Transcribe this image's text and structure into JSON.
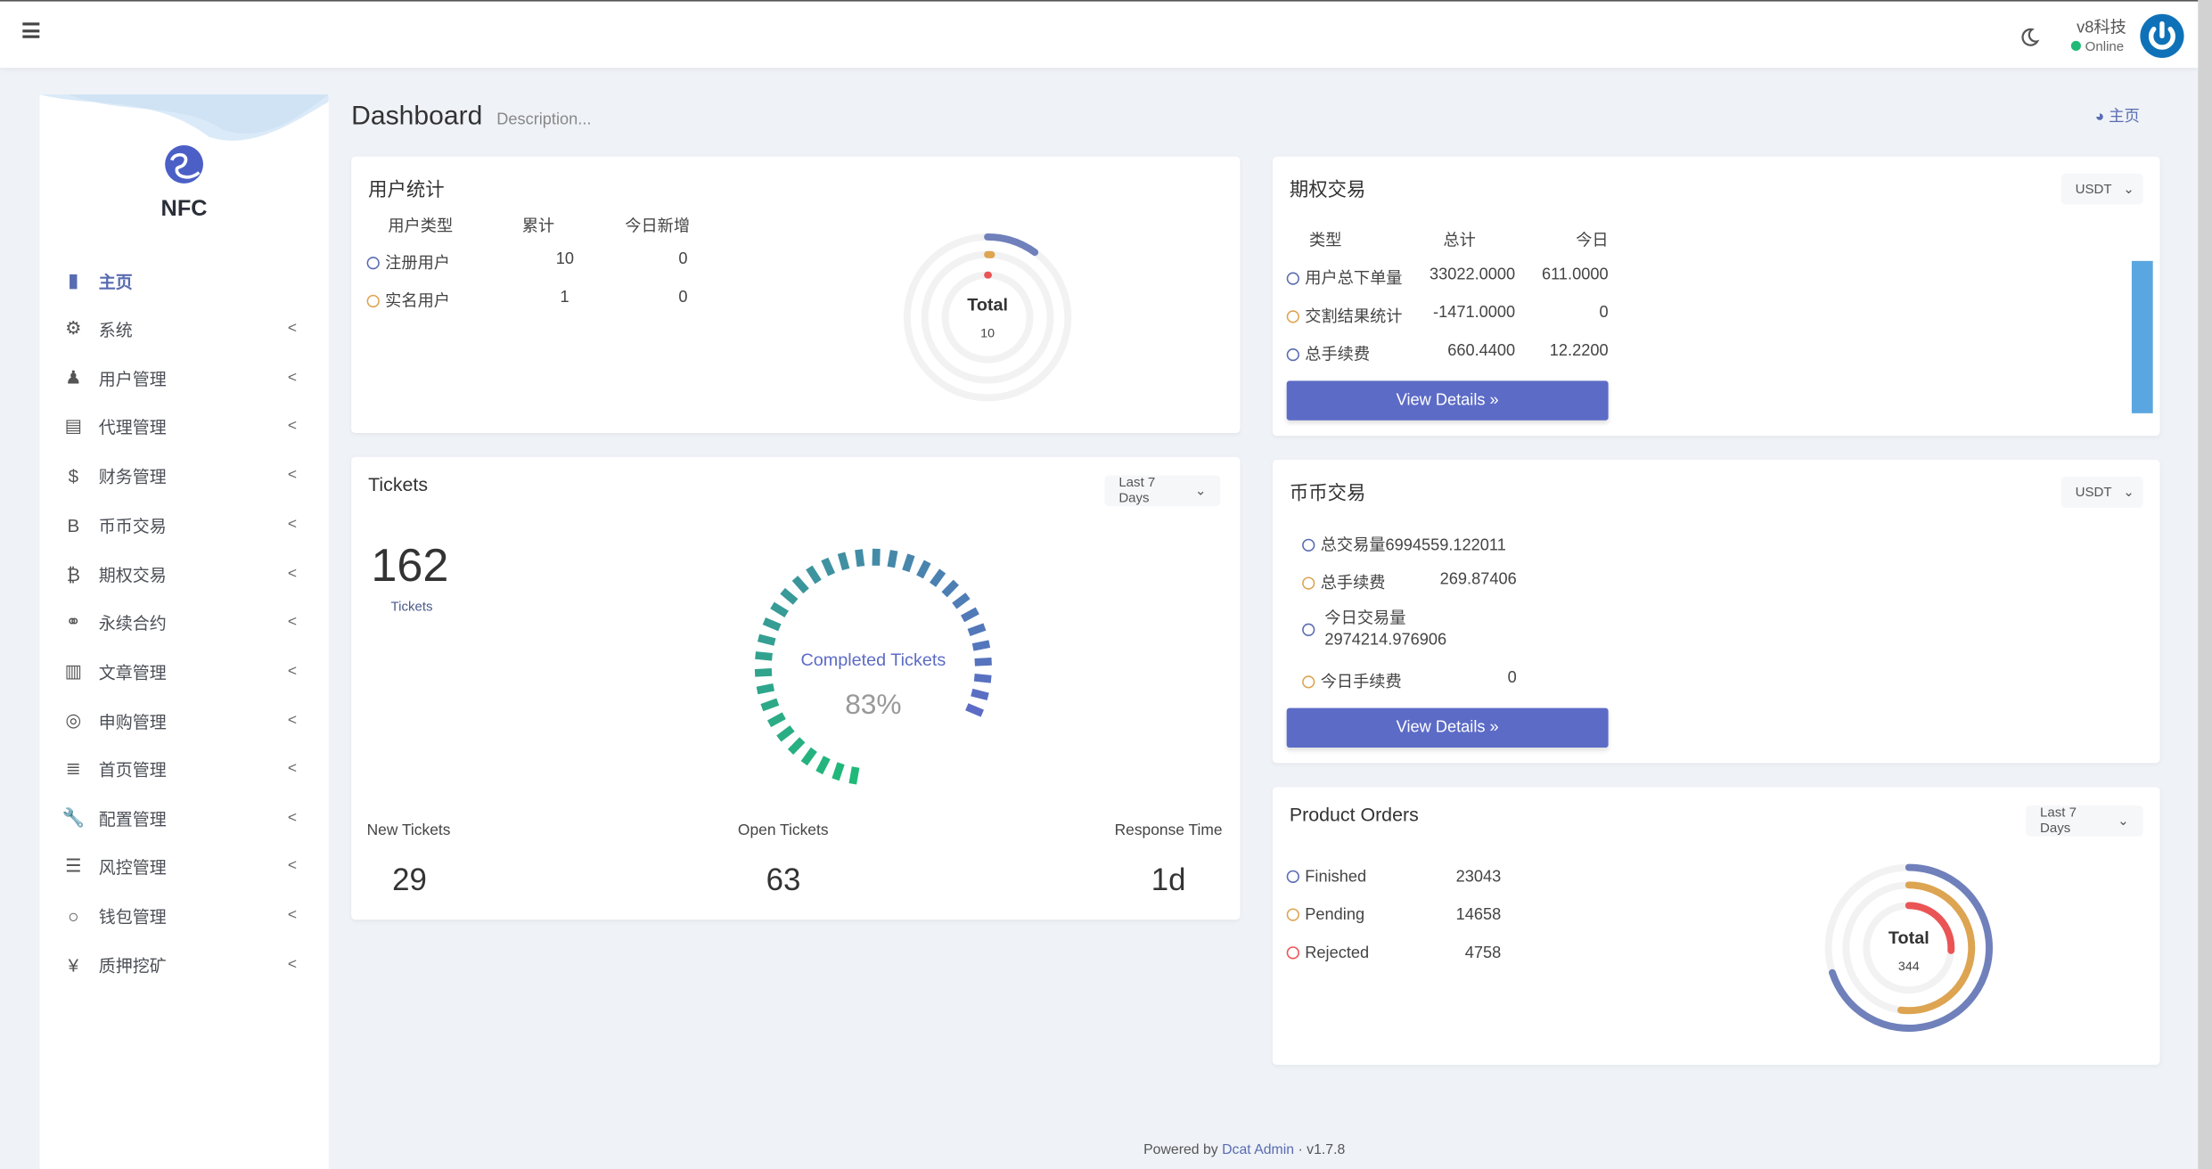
{
  "navbar": {
    "menu_icon": "hamburger-icon",
    "theme_icon": "moon-icon",
    "username": "v8科技",
    "status": "Online",
    "status_color": "#21b978",
    "avatar_icon": "power-icon"
  },
  "sidebar": {
    "logo_text": "NFC",
    "items": [
      {
        "label": "主页",
        "icon": "bar-chart-icon",
        "active": true
      },
      {
        "label": "系统",
        "icon": "gear-icon"
      },
      {
        "label": "用户管理",
        "icon": "user-icon"
      },
      {
        "label": "代理管理",
        "icon": "id-card-icon"
      },
      {
        "label": "财务管理",
        "icon": "dollar-icon"
      },
      {
        "label": "币币交易",
        "icon": "b-letter-icon"
      },
      {
        "label": "期权交易",
        "icon": "bitcoin-icon"
      },
      {
        "label": "永续合约",
        "icon": "link-icon"
      },
      {
        "label": "文章管理",
        "icon": "newspaper-icon"
      },
      {
        "label": "申购管理",
        "icon": "life-ring-icon"
      },
      {
        "label": "首页管理",
        "icon": "list-icon"
      },
      {
        "label": "配置管理",
        "icon": "wrench-icon"
      },
      {
        "label": "风控管理",
        "icon": "indent-icon"
      },
      {
        "label": "钱包管理",
        "icon": "circle-icon"
      },
      {
        "label": "质押挖矿",
        "icon": "yen-icon"
      }
    ]
  },
  "header": {
    "title": "Dashboard",
    "description": "Description...",
    "breadcrumb": "主页"
  },
  "user_stats": {
    "title": "用户统计",
    "columns": [
      "用户类型",
      "累计",
      "今日新增"
    ],
    "rows": [
      {
        "type": "注册用户",
        "total": "10",
        "today": "0"
      },
      {
        "type": "实名用户",
        "total": "1",
        "today": "0"
      }
    ],
    "chart_total_label": "Total",
    "chart_total": "10",
    "chart_values": [
      10,
      1,
      0
    ]
  },
  "options_trade": {
    "title": "期权交易",
    "select": "USDT",
    "columns": [
      "类型",
      "总计",
      "今日"
    ],
    "rows": [
      {
        "type": "用户总下单量",
        "total": "33022.0000",
        "today": "611.0000"
      },
      {
        "type": "交割结果统计",
        "total": "-1471.0000",
        "today": "0"
      },
      {
        "type": "总手续费",
        "total": "660.4400",
        "today": "12.2200"
      }
    ],
    "button": "View Details »"
  },
  "tickets": {
    "title": "Tickets",
    "select": "Last 7 Days",
    "count": "162",
    "count_label": "Tickets",
    "gauge_label": "Completed Tickets",
    "gauge_value": 83,
    "gauge_text": "83%",
    "stats": [
      {
        "label": "New Tickets",
        "value": "29"
      },
      {
        "label": "Open Tickets",
        "value": "63"
      },
      {
        "label": "Response Time",
        "value": "1d"
      }
    ]
  },
  "coin_trade": {
    "title": "币币交易",
    "select": "USDT",
    "rows": [
      {
        "label": "总交易量",
        "value": "6994559.122011"
      },
      {
        "label": "总手续费",
        "value": "269.87406"
      },
      {
        "label": "今日交易量",
        "value": "2974214.976906"
      },
      {
        "label": "今日手续费",
        "value": "0"
      }
    ],
    "button": "View Details »"
  },
  "product_orders": {
    "title": "Product Orders",
    "select": "Last 7 Days",
    "rows": [
      {
        "label": "Finished",
        "value": "23043"
      },
      {
        "label": "Pending",
        "value": "14658"
      },
      {
        "label": "Rejected",
        "value": "4758"
      }
    ],
    "chart_total_label": "Total",
    "chart_total": "344",
    "chart_values": [
      70,
      52,
      26
    ]
  },
  "colors": {
    "primary": "#586cb1",
    "warning": "#dda451",
    "danger": "#ea5455",
    "button": "#5c6bc6"
  },
  "footer": {
    "prefix": "Powered by",
    "link": "Dcat Admin",
    "version": "v1.7.8"
  }
}
